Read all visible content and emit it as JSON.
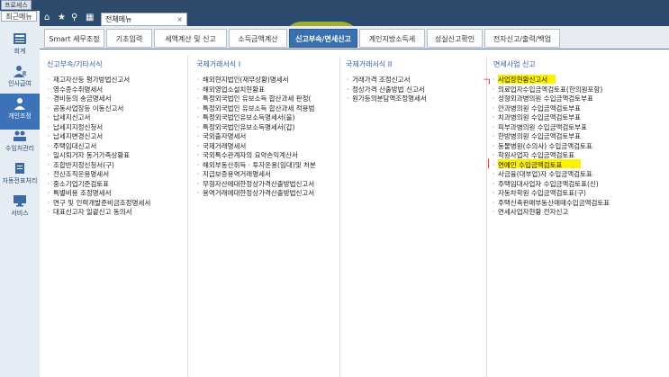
{
  "topbar": {
    "btn1": "프로세스",
    "btn2": "최근메뉴"
  },
  "header": {
    "menu_tab_label": "전체메뉴",
    "close_glyph": "×"
  },
  "leftnav": {
    "items": [
      {
        "label": "회계",
        "icon": "ledger-icon"
      },
      {
        "label": "인사급여",
        "icon": "person-icon"
      },
      {
        "label": "개인조정",
        "icon": "person-icon"
      },
      {
        "label": "수임처관리",
        "icon": "people-icon"
      },
      {
        "label": "자동전표처리",
        "icon": "document-icon"
      },
      {
        "label": "서비스",
        "icon": "monitor-icon"
      }
    ]
  },
  "tabs": [
    {
      "label": "Smart 세무조정"
    },
    {
      "label": "기초입력"
    },
    {
      "label": "세액계산 및 신고"
    },
    {
      "label": "소득금액계산"
    },
    {
      "label": "신고부속/면세신고"
    },
    {
      "label": "계인지방소득세"
    },
    {
      "label": "성실신고확인"
    },
    {
      "label": "전자신고/출력/백업"
    }
  ],
  "columns": [
    {
      "title": "신고부속/기타서식",
      "items": [
        "재고자산등 평가방법신고서",
        "영수증수취명세서",
        "경비등의 송금명세서",
        "공동사업장등 이동신고서",
        "납세지신고서",
        "납세지지정신청서",
        "납세지변경신고서",
        "주택임대신고서",
        "일시퇴거자 동거가족상황표",
        "조합반지정신청서(구)",
        "전산조직운용명세서",
        "중소기업기준검토표",
        "특별비용 조정명세서",
        "연구 및 인력개발준비금조정명세서",
        "대표신고자 일괄신고 동의서"
      ]
    },
    {
      "title": "국제거래서식 I",
      "items": [
        "해외현지법인(재무상황)명세서",
        "해외영업소설치현황표",
        "특정외국법인 유보소득 합산과세 판정(",
        "특정외국법인 유보소득 합산과세 적용범",
        "특정외국법인유보소득명세서(을)",
        "특정외국법인유보소득명세서(갑)",
        "국외출자명세서",
        "국제거래명세서",
        "국외특수관계자의 요약손익계산서",
        "해외부동산취득 · 투자운용(임대)및 처분",
        "지급보증용역거래명세서",
        "무형자산에대한정상가격산출방법신고서",
        "용역거래에대한정상가격산출방법신고서"
      ]
    },
    {
      "title": "국제거래서식 II",
      "items": [
        "거래가격 조정신고서",
        "정상가격 산출방법 신고서",
        "원가등의분담액조정명세서"
      ]
    },
    {
      "title": "면세사업 신고",
      "items": [
        "사업장현황신고서",
        "의료업자수입금액검토표(한의원포함)",
        "성형외과병의원 수입금액검토부표",
        "안과병의원 수입금액검토부표",
        "치과병의원 수입금액검토부표",
        "피부과병의원 수입금액검토부표",
        "한방병의원 수입금액검토부표",
        "동물병원(수의사) 수입금액검토표",
        "학원사업자 수입금액검토표",
        "연예인 수입금액검토표",
        "사금융(대부업)자 수입금액검토표",
        "주택임대사업자 수입금액검토표(신)",
        "자동차학원 수입금액검토표(구)",
        "주택신축판매부동산매매수입금액검토표",
        "면세사업자현황 전자신고"
      ]
    }
  ],
  "annotations": {
    "mark1": "ㄱ",
    "mark2": "ㅣ"
  },
  "colors": {
    "accent": "#3a6fb0",
    "highlight": "#fff200",
    "header": "#2b4b6e"
  }
}
